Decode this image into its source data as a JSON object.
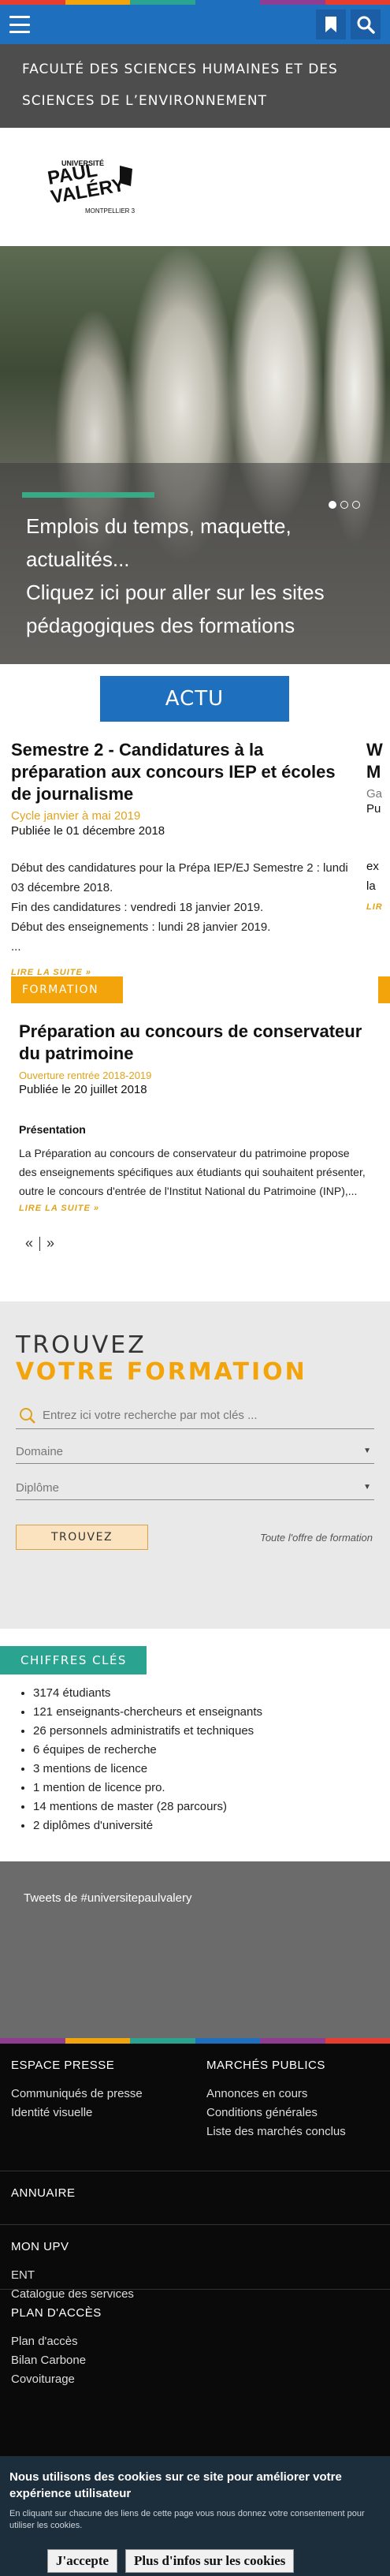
{
  "brand_stripe_colors": [
    "#e63d30",
    "#f3a40a",
    "#2aa391",
    "#1f6fbf",
    "#8f3c93",
    "#e63d30"
  ],
  "header": {
    "menu_icon": "hamburger-icon",
    "bookmark_icon": "bookmark-icon",
    "search_icon": "search-icon",
    "faculty_title": "FACULTÉ DES SCIENCES HUMAINES ET DES SCIENCES DE L’ENVIRONNEMENT"
  },
  "logo": {
    "line1": "UNIVERSITÉ",
    "line2": "PAUL",
    "line3": "VALÉRY",
    "line4": "MONTPELLIER 3"
  },
  "hero": {
    "caption_line1": "Emplois du temps, maquette, actualités...",
    "caption_line2": "Cliquez ici pour aller sur les sites pédagogiques des formations",
    "active_slide": 1,
    "slide_count": 3
  },
  "actu": {
    "button_label": "ACTU",
    "article": {
      "title": "Semestre 2 - Candidatures à la préparation aux concours IEP et écoles de journalisme",
      "meta": "Cycle janvier à mai 2019",
      "published": "Publiée le 01 décembre 2018",
      "body": "Début des candidatures pour la Prépa IEP/EJ Semestre 2 : lundi 03 décembre 2018.\nFin des candidatures : vendredi 18 janvier 2019.\nDébut des enseignements : lundi 28 janvier 2019.\n...",
      "read_more": "LIRE LA SUITE"
    },
    "peek": {
      "title": "W\nM",
      "meta": "Ga",
      "published": "Pu",
      "body": "ex\nla",
      "read_more": "LIR"
    },
    "pager_prev": "«",
    "pager_next": "»"
  },
  "formation": {
    "tag": "FORMATION",
    "title": "Préparation au concours de conservateur du patrimoine",
    "meta": "Ouverture rentrée 2018-2019",
    "published": "Publiée le 20 juillet 2018",
    "section_title": "Présentation",
    "body": "La Préparation au concours de conservateur du patrimoine propose des enseignements spécifiques aux étudiants qui souhaitent présenter, outre le concours d'entrée de l'Institut National du Patrimoine (INP),...",
    "read_more": "LIRE LA SUITE",
    "pager_prev": "«",
    "pager_next": "»"
  },
  "search": {
    "title_line1": "TROUVEZ",
    "title_line2": "VOTRE FORMATION",
    "placeholder": "Entrez ici votre recherche par mot clés ...",
    "domain_label": "Domaine",
    "diploma_label": "Diplôme",
    "submit_label": "TROUVEZ",
    "all_offer": "Toute l'offre de formation"
  },
  "chiffres": {
    "tag": "CHIFFRES CLÉS",
    "items": [
      "3174 étudiants",
      "121 enseignants-chercheurs et enseignants",
      "26 personnels administratifs et techniques",
      "6 équipes de recherche",
      "3 mentions de licence",
      "1 mention de licence pro.",
      "14 mentions de master (28 parcours)",
      "2 diplômes d'université"
    ]
  },
  "tweets": {
    "label": "Tweets de #universitepaulvalery"
  },
  "footer": {
    "presse": {
      "title": "ESPACE PRESSE",
      "links": [
        "Communiqués de presse",
        "Identité visuelle"
      ]
    },
    "marches": {
      "title": "MARCHÉS PUBLICS",
      "links": [
        "Annonces en cours",
        "Conditions générales",
        "Liste des marchés conclus"
      ]
    },
    "annuaire": {
      "title": "ANNUAIRE"
    },
    "monupv": {
      "title": "MON UPV",
      "links": [
        "ENT",
        "Catalogue des services"
      ]
    },
    "acces": {
      "title": "PLAN D'ACCÈS",
      "links": [
        "Plan d'accès",
        "Bilan Carbone",
        "Covoiturage"
      ]
    }
  },
  "cookie": {
    "title": "Nous utilisons des cookies sur ce site pour améliorer votre expérience utilisateur",
    "subtitle": "En cliquant sur chacune des liens de cette page vous nous donnez votre consentement pour utiliser les cookies.",
    "accept": "J'accepte",
    "more": "Plus d'infos sur les cookies"
  }
}
